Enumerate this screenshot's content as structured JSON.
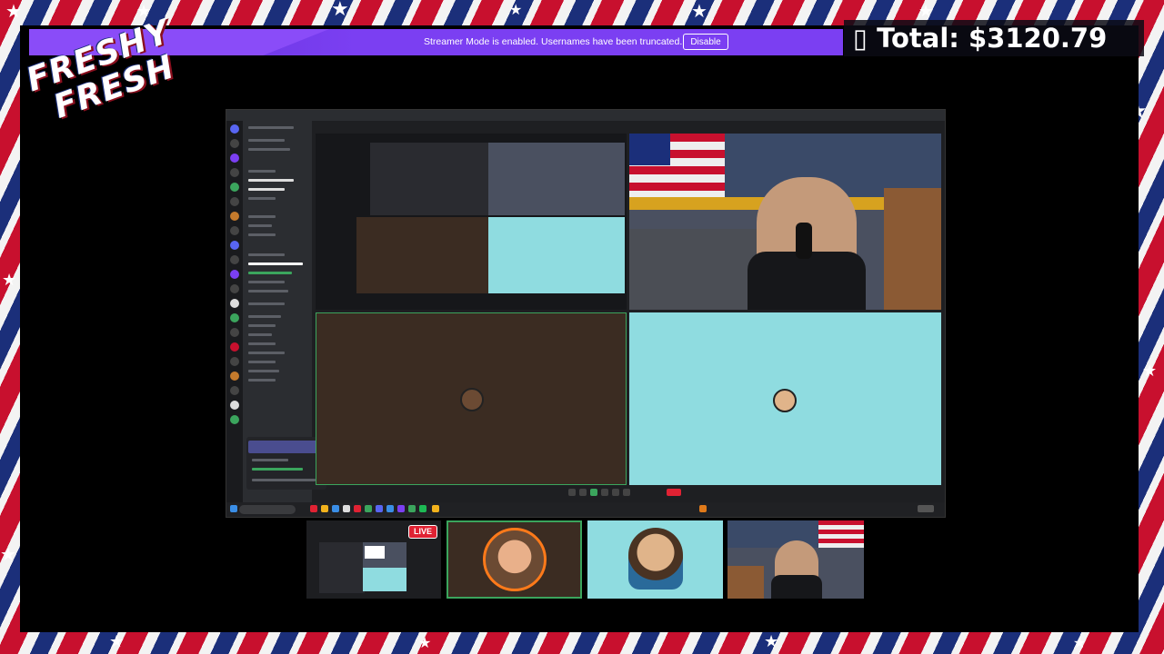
{
  "streamer_bar": {
    "message": "Streamer Mode is enabled. Usernames have been truncated.",
    "disable_label": "Disable"
  },
  "total": {
    "label": "Total: $3120.79",
    "icon": "box-placeholder-glyph",
    "glyph": "▯"
  },
  "logo": {
    "line1": "FRESHY",
    "line2": "FRESH"
  },
  "overlay": {
    "live_badge": "LIVE"
  },
  "colors": {
    "streamer_purple": "#7b3ff2",
    "live_red": "#e02233",
    "speaking_green": "#3ba55d",
    "cyan_tile": "#8fdce0",
    "brown_tile": "#3b2c22"
  }
}
